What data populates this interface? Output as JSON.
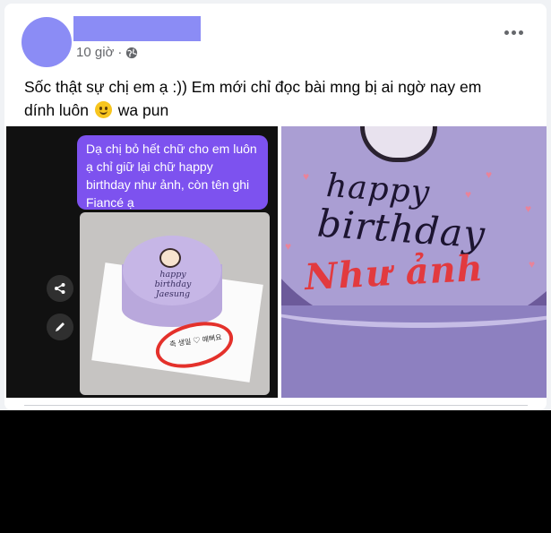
{
  "post": {
    "time": "10 giờ",
    "separator": "·",
    "text_line1": "Sốc thật sự chị em ạ :)) Em mới chỉ đọc bài mng bị ai ngờ nay em",
    "text_line2_a": "dính luôn",
    "text_line2_b": "wa pun"
  },
  "photo_left": {
    "chat_message": "Dạ chị bỏ hết chữ cho em luôn ạ chỉ giữ lại chữ happy birthday như ảnh, còn tên ghi Fiancé ạ",
    "cake_line1": "happy",
    "cake_line2": "birthday",
    "cake_line3": "Jaesung",
    "korean_note": "축 생일 ♡ 예뻐요"
  },
  "photo_right": {
    "cake_line1": "happy",
    "cake_line2": "birthday",
    "cake_line3": "Như ảnh"
  },
  "icons": {
    "globe": "globe-icon",
    "more": "more-icon",
    "share": "share-icon",
    "edit": "pencil-icon",
    "emoji": "smile-emoji-icon"
  },
  "colors": {
    "avatar": "#8b8cf5",
    "chat_bubble": "#7d52ef",
    "circle_mark": "#e4312b"
  }
}
